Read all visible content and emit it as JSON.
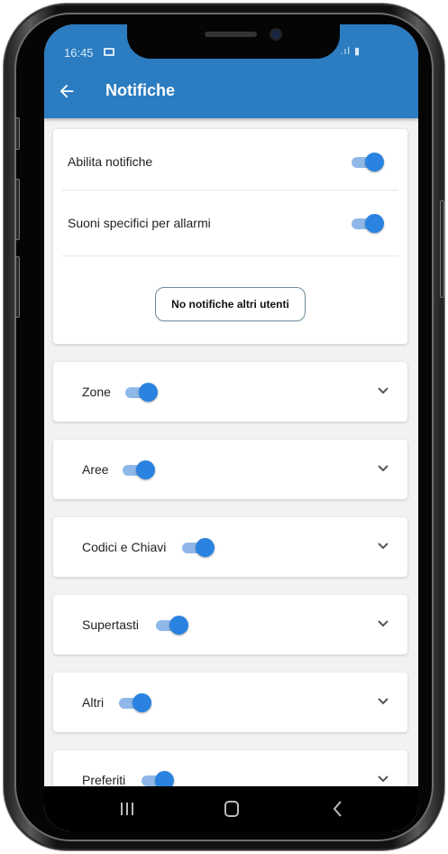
{
  "status_bar": {
    "time": "16:45",
    "signal": ".ıl ▮"
  },
  "app_bar": {
    "title": "Notifiche"
  },
  "settings_card": {
    "enable_notifications_label": "Abilita notifiche",
    "enable_notifications_on": true,
    "alarm_sounds_label": "Suoni specifici per allarmi",
    "alarm_sounds_on": true,
    "other_users_button": "No notifiche altri utenti"
  },
  "sections": [
    {
      "label": "Zone",
      "enabled": true
    },
    {
      "label": "Aree",
      "enabled": true
    },
    {
      "label": "Codici e Chiavi",
      "enabled": true
    },
    {
      "label": "Supertasti",
      "enabled": true
    },
    {
      "label": "Altri",
      "enabled": true
    },
    {
      "label": "Preferiti",
      "enabled": true
    }
  ],
  "colors": {
    "primary": "#2b7cc0",
    "toggle_thumb": "#2a83e0",
    "toggle_track": "#8fb8e8",
    "background": "#f2f2f2"
  },
  "icons": {
    "back": "arrow-left-icon",
    "expand": "chevron-down-icon",
    "nav_recent": "recent-apps-icon",
    "nav_home": "home-icon",
    "nav_back": "chevron-left-icon"
  }
}
